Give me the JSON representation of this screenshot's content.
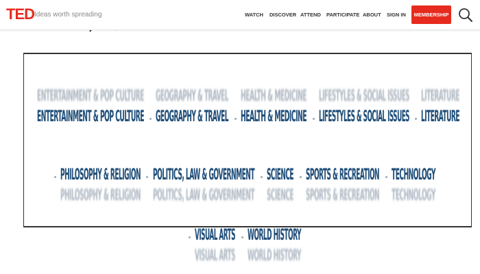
{
  "header": {
    "logo_text": "TED",
    "tagline": "Ideas worth spreading",
    "nav": [
      "WATCH",
      "DISCOVER",
      "ATTEND",
      "PARTICIPATE",
      "ABOUT",
      "SIGN IN"
    ],
    "membership_label": "MEMBERSHIP",
    "search_icon": "search-icon"
  },
  "colors": {
    "brand_red": "#e62b1e",
    "topic_blue": "#1f4e79",
    "nav_text": "#333333"
  },
  "topics": {
    "row1": [
      "ENTERTAINMENT & POP CULTURE",
      "GEOGRAPHY & TRAVEL",
      "HEALTH & MEDICINE",
      "LIFESTYLES & SOCIAL ISSUES",
      "LITERATURE"
    ],
    "row2": [
      "PHILOSOPHY & RELIGION",
      "POLITICS, LAW & GOVERNMENT",
      "SCIENCE",
      "SPORTS & RECREATION",
      "TECHNOLOGY"
    ],
    "row3": [
      "VISUAL ARTS",
      "WORLD HISTORY"
    ]
  }
}
